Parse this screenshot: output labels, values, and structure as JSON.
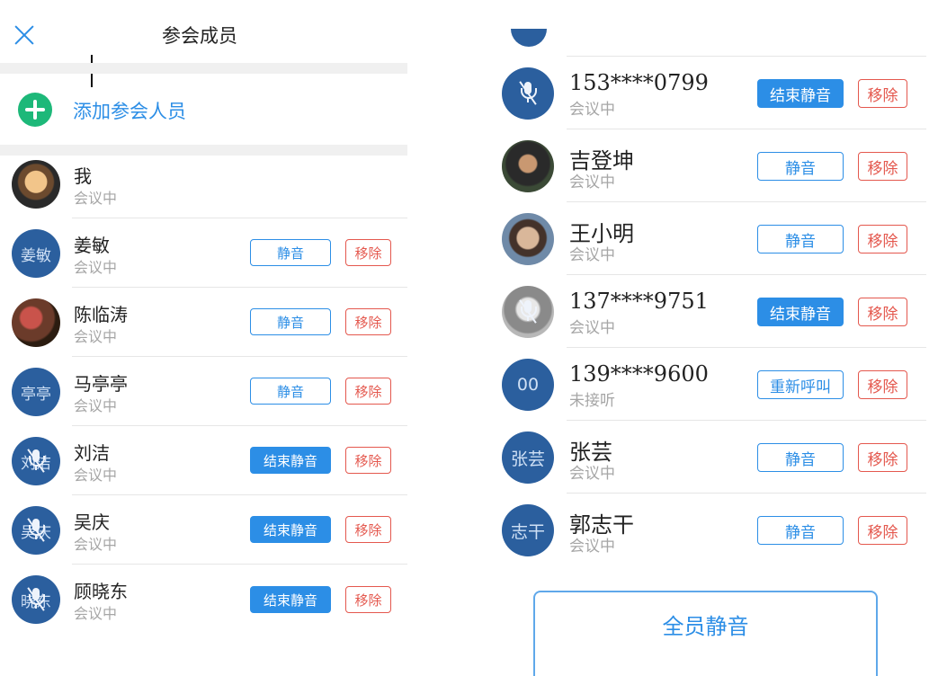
{
  "header": {
    "title": "参会成员",
    "close_icon": "close-icon"
  },
  "add_member": {
    "label": "添加参会人员",
    "icon": "plus-circle-icon"
  },
  "colors": {
    "accent": "#2c8ee6",
    "danger": "#e4584e",
    "add_green": "#1db879",
    "avatar_blue": "#2b5f9e"
  },
  "left_members": [
    {
      "name": "我",
      "status": "会议中",
      "avatar_text": "",
      "avatar_kind": "photo",
      "mic_off": false
    },
    {
      "name": "姜敏",
      "status": "会议中",
      "avatar_text": "姜敏",
      "avatar_kind": "initials",
      "mic_off": false,
      "action": "静音",
      "remove": "移除"
    },
    {
      "name": "陈临涛",
      "status": "会议中",
      "avatar_text": "",
      "avatar_kind": "photo2",
      "mic_off": false,
      "action": "静音",
      "remove": "移除"
    },
    {
      "name": "马亭亭",
      "status": "会议中",
      "avatar_text": "亭亭",
      "avatar_kind": "initials",
      "mic_off": false,
      "action": "静音",
      "remove": "移除"
    },
    {
      "name": "刘洁",
      "status": "会议中",
      "avatar_text": "刘洁",
      "avatar_kind": "initials",
      "mic_off": true,
      "action": "结束静音",
      "remove": "移除"
    },
    {
      "name": "吴庆",
      "status": "会议中",
      "avatar_text": "吴庆",
      "avatar_kind": "initials",
      "mic_off": true,
      "action": "结束静音",
      "remove": "移除"
    },
    {
      "name": "顾晓东",
      "status": "会议中",
      "avatar_text": "晓东",
      "avatar_kind": "initials",
      "mic_off": true,
      "action": "结束静音",
      "remove": "移除"
    }
  ],
  "right_members": [
    {
      "name": "153****0799",
      "status": "会议中",
      "avatar_text": "",
      "avatar_kind": "initials",
      "mic_off": true,
      "action": "结束静音",
      "remove": "移除"
    },
    {
      "name": "吉登坤",
      "status": "会议中",
      "avatar_text": "",
      "avatar_kind": "photo-a",
      "mic_off": false,
      "action": "静音",
      "remove": "移除"
    },
    {
      "name": "王小明",
      "status": "会议中",
      "avatar_text": "",
      "avatar_kind": "photo-b",
      "mic_off": false,
      "action": "静音",
      "remove": "移除"
    },
    {
      "name": "137****9751",
      "status": "会议中",
      "avatar_text": "",
      "avatar_kind": "photo-c",
      "mic_off": true,
      "action": "结束静音",
      "remove": "移除"
    },
    {
      "name": "139****9600",
      "status": "未接听",
      "avatar_text": "00",
      "avatar_kind": "initials",
      "mic_off": false,
      "action": "重新呼叫",
      "remove": "移除"
    },
    {
      "name": "张芸",
      "status": "会议中",
      "avatar_text": "张芸",
      "avatar_kind": "initials",
      "mic_off": false,
      "action": "静音",
      "remove": "移除"
    },
    {
      "name": "郭志干",
      "status": "会议中",
      "avatar_text": "志干",
      "avatar_kind": "initials",
      "mic_off": false,
      "action": "静音",
      "remove": "移除"
    }
  ],
  "footer": {
    "mute_all_label": "全员静音"
  }
}
